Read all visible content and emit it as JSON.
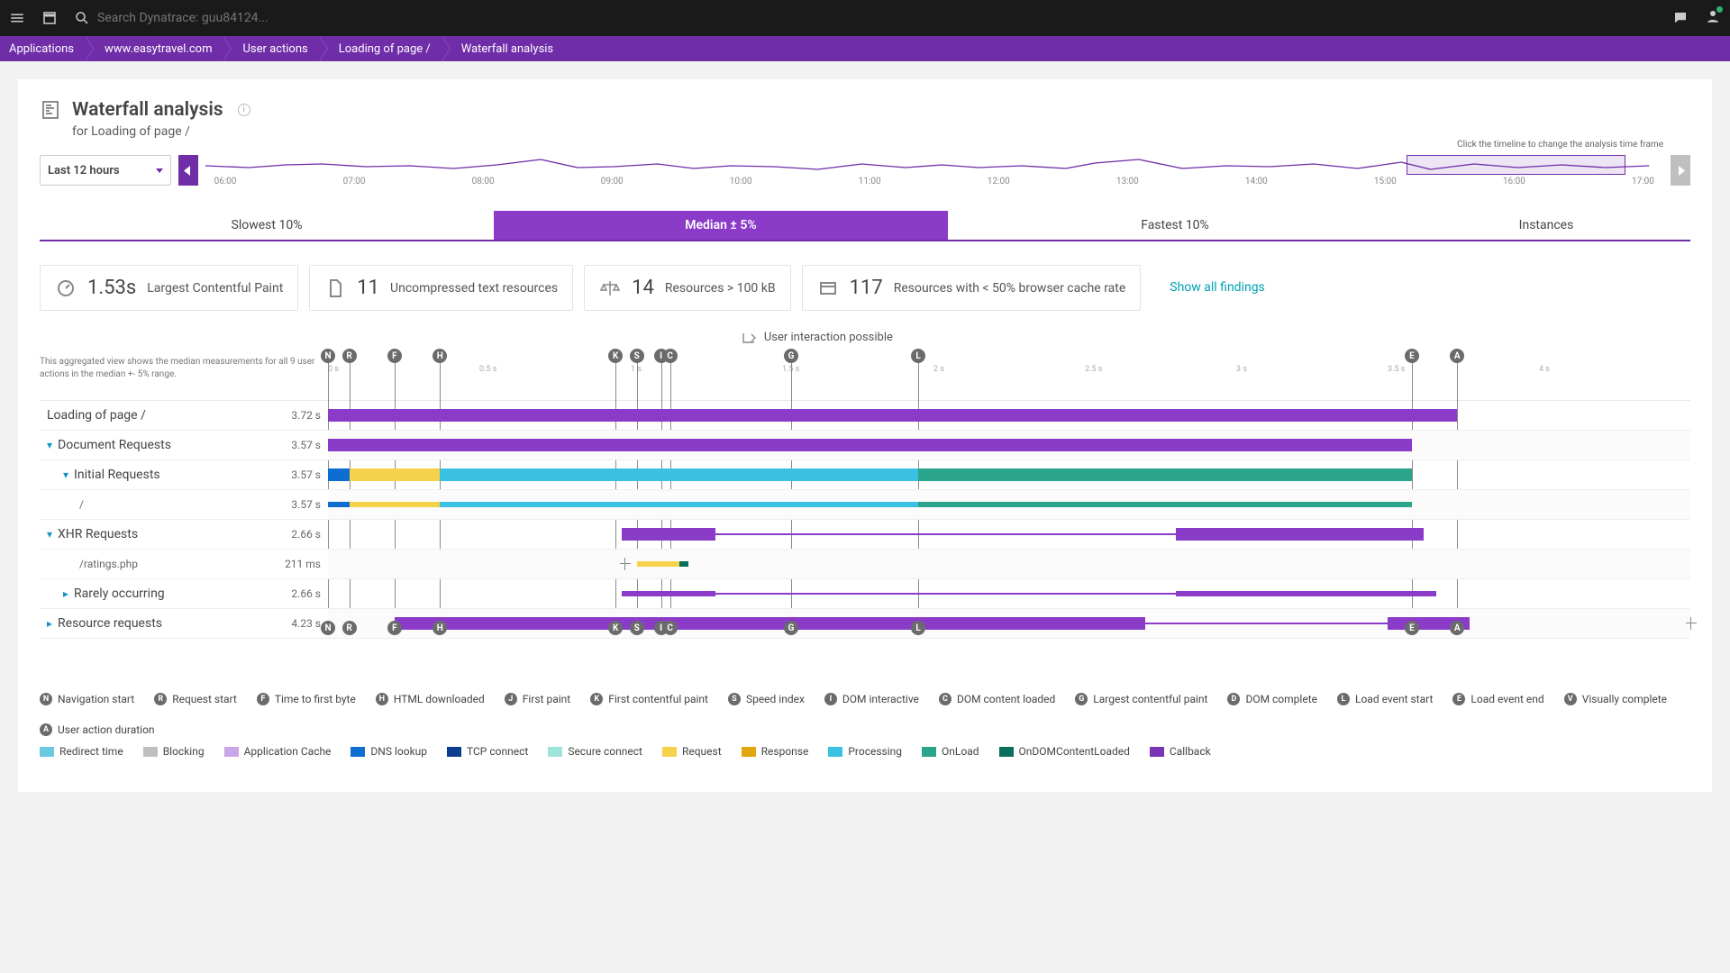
{
  "topbar": {
    "search_placeholder": "Search Dynatrace: guu84124..."
  },
  "breadcrumbs": [
    "Applications",
    "www.easytravel.com",
    "User actions",
    "Loading of page /",
    "Waterfall analysis"
  ],
  "page_title": "Waterfall analysis",
  "page_sub": "for Loading of page /",
  "timeframe": {
    "label": "Last 12 hours"
  },
  "timeline": {
    "hint": "Click the timeline to change the analysis time frame",
    "ticks": [
      "06:00",
      "07:00",
      "08:00",
      "09:00",
      "10:00",
      "11:00",
      "12:00",
      "13:00",
      "14:00",
      "15:00",
      "16:00",
      "17:00"
    ]
  },
  "tabs": [
    "Slowest 10%",
    "Median ± 5%",
    "Fastest 10%",
    "Instances"
  ],
  "active_tab": 1,
  "findings": [
    {
      "value": "1.53s",
      "label": "Largest Contentful Paint",
      "icon": "gauge"
    },
    {
      "value": "11",
      "label": "Uncompressed text resources",
      "icon": "file"
    },
    {
      "value": "14",
      "label": "Resources > 100 kB",
      "icon": "scale"
    },
    {
      "value": "117",
      "label": "Resources with < 50% browser cache rate",
      "icon": "browser"
    }
  ],
  "show_all": "Show all findings",
  "uip_label": "User interaction possible",
  "wf_desc": "This aggregated view shows the median measurements for all 9 user actions in the median +- 5% range.",
  "chart_data": {
    "type": "bar",
    "x_unit": "s",
    "xlim": [
      0,
      4.5
    ],
    "time_ticks": [
      0,
      0.5,
      1,
      1.5,
      2,
      2.5,
      3,
      3.5,
      4
    ],
    "markers": [
      {
        "id": "N",
        "label": "Navigation start",
        "pos": 0.0
      },
      {
        "id": "R",
        "label": "Request start",
        "pos": 0.07
      },
      {
        "id": "F",
        "label": "Time to first byte",
        "pos": 0.22
      },
      {
        "id": "H",
        "label": "HTML downloaded",
        "pos": 0.37
      },
      {
        "id": "K",
        "label": "First contentful paint",
        "pos": 0.95
      },
      {
        "id": "S",
        "label": "Speed index",
        "pos": 1.02
      },
      {
        "id": "I",
        "label": "DOM interactive",
        "pos": 1.1
      },
      {
        "id": "C",
        "label": "DOM content loaded",
        "pos": 1.13
      },
      {
        "id": "G",
        "label": "Largest contentful paint",
        "pos": 1.53
      },
      {
        "id": "L",
        "label": "Load event start",
        "pos": 1.95
      },
      {
        "id": "E",
        "label": "Load event end",
        "pos": 3.58
      },
      {
        "id": "A",
        "label": "User action duration",
        "pos": 3.73
      }
    ],
    "rows": [
      {
        "label": "Loading of page /",
        "value": "3.72 s",
        "indent": 0,
        "bars": [
          {
            "c": "c-main",
            "s": 0,
            "e": 3.73
          }
        ]
      },
      {
        "label": "Document Requests",
        "value": "3.57 s",
        "indent": 0,
        "expand": true,
        "bars": [
          {
            "c": "c-main",
            "s": 0,
            "e": 3.58
          }
        ]
      },
      {
        "label": "Initial Requests",
        "value": "3.57 s",
        "indent": 1,
        "expand": true,
        "bars": [
          {
            "c": "c-dns",
            "s": 0,
            "e": 0.07
          },
          {
            "c": "c-request",
            "s": 0.07,
            "e": 0.37
          },
          {
            "c": "c-process",
            "s": 0.37,
            "e": 1.95
          },
          {
            "c": "c-onload",
            "s": 1.95,
            "e": 3.58
          }
        ]
      },
      {
        "label": "/",
        "value": "3.57 s",
        "indent": 2,
        "thin": true,
        "bars": [
          {
            "c": "c-dns",
            "s": 0,
            "e": 0.07
          },
          {
            "c": "c-request",
            "s": 0.07,
            "e": 0.37
          },
          {
            "c": "c-process",
            "s": 0.37,
            "e": 1.95
          },
          {
            "c": "c-onload",
            "s": 1.95,
            "e": 3.58
          }
        ]
      },
      {
        "label": "XHR Requests",
        "value": "2.66 s",
        "indent": 0,
        "expand": true,
        "bars": [
          {
            "c": "c-main",
            "s": 0.97,
            "e": 1.28
          },
          {
            "c": "c-main",
            "s": 1.28,
            "e": 2.8,
            "line": true
          },
          {
            "c": "c-main",
            "s": 2.8,
            "e": 3.62
          }
        ]
      },
      {
        "label": "/ratings.php",
        "value": "211 ms",
        "indent": 2,
        "thin": true,
        "whisk": [
          0.98,
          1.02
        ],
        "bars": [
          {
            "c": "c-request",
            "s": 1.02,
            "e": 1.16
          },
          {
            "c": "c-ondom",
            "s": 1.16,
            "e": 1.19
          }
        ]
      },
      {
        "label": "Rarely occurring",
        "value": "2.66 s",
        "indent": 1,
        "collapse": true,
        "thin": true,
        "bars": [
          {
            "c": "c-main",
            "s": 0.97,
            "e": 1.28
          },
          {
            "c": "c-main",
            "s": 1.28,
            "e": 2.8,
            "line": true
          },
          {
            "c": "c-main",
            "s": 2.8,
            "e": 3.66
          }
        ]
      },
      {
        "label": "Resource requests",
        "value": "4.23 s",
        "indent": 0,
        "collapse": true,
        "bars": [
          {
            "c": "c-main",
            "s": 0.22,
            "e": 2.7
          },
          {
            "c": "c-main",
            "s": 2.7,
            "e": 3.5,
            "line": true
          },
          {
            "c": "c-main",
            "s": 3.5,
            "e": 3.77
          }
        ],
        "whisk_end": 4.5
      }
    ]
  },
  "marker_legend": [
    {
      "id": "N",
      "label": "Navigation start"
    },
    {
      "id": "R",
      "label": "Request start"
    },
    {
      "id": "F",
      "label": "Time to first byte"
    },
    {
      "id": "H",
      "label": "HTML downloaded"
    },
    {
      "id": "J",
      "label": "First paint"
    },
    {
      "id": "K",
      "label": "First contentful paint"
    },
    {
      "id": "S",
      "label": "Speed index"
    },
    {
      "id": "I",
      "label": "DOM interactive"
    },
    {
      "id": "C",
      "label": "DOM content loaded"
    },
    {
      "id": "G",
      "label": "Largest contentful paint"
    },
    {
      "id": "D",
      "label": "DOM complete"
    },
    {
      "id": "L",
      "label": "Load event start"
    },
    {
      "id": "E",
      "label": "Load event end"
    },
    {
      "id": "V",
      "label": "Visually complete"
    },
    {
      "id": "A",
      "label": "User action duration"
    }
  ],
  "color_legend": [
    {
      "c": "c-redirect",
      "label": "Redirect time"
    },
    {
      "c": "c-block",
      "label": "Blocking"
    },
    {
      "c": "c-appcache",
      "label": "Application Cache"
    },
    {
      "c": "c-dns",
      "label": "DNS lookup"
    },
    {
      "c": "c-tcp",
      "label": "TCP connect"
    },
    {
      "c": "c-secure",
      "label": "Secure connect"
    },
    {
      "c": "c-request",
      "label": "Request"
    },
    {
      "c": "c-response",
      "label": "Response"
    },
    {
      "c": "c-process",
      "label": "Processing"
    },
    {
      "c": "c-onload",
      "label": "OnLoad"
    },
    {
      "c": "c-ondom",
      "label": "OnDOMContentLoaded"
    },
    {
      "c": "c-callback",
      "label": "Callback"
    }
  ]
}
